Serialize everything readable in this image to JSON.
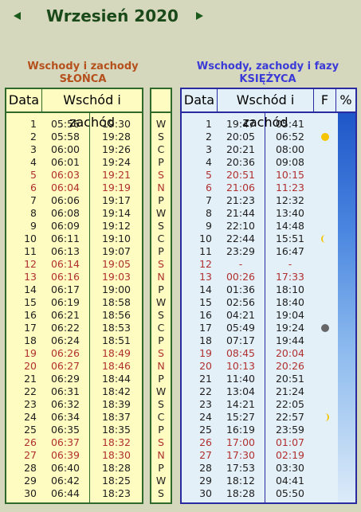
{
  "nav": {
    "prev": "previous-month",
    "next": "next-month"
  },
  "title": "Wrzesień 2020",
  "sun_section": {
    "line1": "Wschody i zachody",
    "line2": "SŁOŃCA"
  },
  "moon_section": {
    "line1": "Wschody, zachody i fazy",
    "line2": "KSIĘŻYCA"
  },
  "sun_headers": {
    "date": "Data",
    "times": "Wschód i zachód"
  },
  "moon_headers": {
    "date": "Data",
    "times": "Wschód i zachód",
    "phase": "F",
    "percent": "%"
  },
  "colors": {
    "weekend": "#b03030",
    "normal": "#1e1e1e",
    "sun_border": "#2f6a2c",
    "moon_border": "#2a2aa0",
    "title": "#1a4a1a"
  },
  "days": [
    {
      "d": "1",
      "sr": "05:56",
      "ss": "19:30",
      "wd": "W",
      "mr": "19:47",
      "ms": "05:41",
      "weekend": false,
      "phase": ""
    },
    {
      "d": "2",
      "sr": "05:58",
      "ss": "19:28",
      "wd": "S",
      "mr": "20:05",
      "ms": "06:52",
      "weekend": false,
      "phase": "full-moon"
    },
    {
      "d": "3",
      "sr": "06:00",
      "ss": "19:26",
      "wd": "C",
      "mr": "20:21",
      "ms": "08:00",
      "weekend": false,
      "phase": ""
    },
    {
      "d": "4",
      "sr": "06:01",
      "ss": "19:24",
      "wd": "P",
      "mr": "20:36",
      "ms": "09:08",
      "weekend": false,
      "phase": ""
    },
    {
      "d": "5",
      "sr": "06:03",
      "ss": "19:21",
      "wd": "S",
      "mr": "20:51",
      "ms": "10:15",
      "weekend": true,
      "phase": ""
    },
    {
      "d": "6",
      "sr": "06:04",
      "ss": "19:19",
      "wd": "N",
      "mr": "21:06",
      "ms": "11:23",
      "weekend": true,
      "phase": ""
    },
    {
      "d": "7",
      "sr": "06:06",
      "ss": "19:17",
      "wd": "P",
      "mr": "21:23",
      "ms": "12:32",
      "weekend": false,
      "phase": ""
    },
    {
      "d": "8",
      "sr": "06:08",
      "ss": "19:14",
      "wd": "W",
      "mr": "21:44",
      "ms": "13:40",
      "weekend": false,
      "phase": ""
    },
    {
      "d": "9",
      "sr": "06:09",
      "ss": "19:12",
      "wd": "S",
      "mr": "22:10",
      "ms": "14:48",
      "weekend": false,
      "phase": ""
    },
    {
      "d": "10",
      "sr": "06:11",
      "ss": "19:10",
      "wd": "C",
      "mr": "22:44",
      "ms": "15:51",
      "weekend": false,
      "phase": "last-quarter"
    },
    {
      "d": "11",
      "sr": "06:13",
      "ss": "19:07",
      "wd": "P",
      "mr": "23:29",
      "ms": "16:47",
      "weekend": false,
      "phase": ""
    },
    {
      "d": "12",
      "sr": "06:14",
      "ss": "19:05",
      "wd": "S",
      "mr": "-",
      "ms": "-",
      "weekend": true,
      "phase": ""
    },
    {
      "d": "13",
      "sr": "06:16",
      "ss": "19:03",
      "wd": "N",
      "mr": "00:26",
      "ms": "17:33",
      "weekend": true,
      "phase": ""
    },
    {
      "d": "14",
      "sr": "06:17",
      "ss": "19:00",
      "wd": "P",
      "mr": "01:36",
      "ms": "18:10",
      "weekend": false,
      "phase": ""
    },
    {
      "d": "15",
      "sr": "06:19",
      "ss": "18:58",
      "wd": "W",
      "mr": "02:56",
      "ms": "18:40",
      "weekend": false,
      "phase": ""
    },
    {
      "d": "16",
      "sr": "06:21",
      "ss": "18:56",
      "wd": "S",
      "mr": "04:21",
      "ms": "19:04",
      "weekend": false,
      "phase": ""
    },
    {
      "d": "17",
      "sr": "06:22",
      "ss": "18:53",
      "wd": "C",
      "mr": "05:49",
      "ms": "19:24",
      "weekend": false,
      "phase": "new-moon"
    },
    {
      "d": "18",
      "sr": "06:24",
      "ss": "18:51",
      "wd": "P",
      "mr": "07:17",
      "ms": "19:44",
      "weekend": false,
      "phase": ""
    },
    {
      "d": "19",
      "sr": "06:26",
      "ss": "18:49",
      "wd": "S",
      "mr": "08:45",
      "ms": "20:04",
      "weekend": true,
      "phase": ""
    },
    {
      "d": "20",
      "sr": "06:27",
      "ss": "18:46",
      "wd": "N",
      "mr": "10:13",
      "ms": "20:26",
      "weekend": true,
      "phase": ""
    },
    {
      "d": "21",
      "sr": "06:29",
      "ss": "18:44",
      "wd": "P",
      "mr": "11:40",
      "ms": "20:51",
      "weekend": false,
      "phase": ""
    },
    {
      "d": "22",
      "sr": "06:31",
      "ss": "18:42",
      "wd": "W",
      "mr": "13:04",
      "ms": "21:24",
      "weekend": false,
      "phase": ""
    },
    {
      "d": "23",
      "sr": "06:32",
      "ss": "18:39",
      "wd": "S",
      "mr": "14:21",
      "ms": "22:05",
      "weekend": false,
      "phase": ""
    },
    {
      "d": "24",
      "sr": "06:34",
      "ss": "18:37",
      "wd": "C",
      "mr": "15:27",
      "ms": "22:57",
      "weekend": false,
      "phase": "first-quarter"
    },
    {
      "d": "25",
      "sr": "06:35",
      "ss": "18:35",
      "wd": "P",
      "mr": "16:19",
      "ms": "23:59",
      "weekend": false,
      "phase": ""
    },
    {
      "d": "26",
      "sr": "06:37",
      "ss": "18:32",
      "wd": "S",
      "mr": "17:00",
      "ms": "01:07",
      "weekend": true,
      "phase": ""
    },
    {
      "d": "27",
      "sr": "06:39",
      "ss": "18:30",
      "wd": "N",
      "mr": "17:30",
      "ms": "02:19",
      "weekend": true,
      "phase": ""
    },
    {
      "d": "28",
      "sr": "06:40",
      "ss": "18:28",
      "wd": "P",
      "mr": "17:53",
      "ms": "03:30",
      "weekend": false,
      "phase": ""
    },
    {
      "d": "29",
      "sr": "06:42",
      "ss": "18:25",
      "wd": "W",
      "mr": "18:12",
      "ms": "04:41",
      "weekend": false,
      "phase": ""
    },
    {
      "d": "30",
      "sr": "06:44",
      "ss": "18:23",
      "wd": "S",
      "mr": "18:28",
      "ms": "05:50",
      "weekend": false,
      "phase": ""
    }
  ]
}
